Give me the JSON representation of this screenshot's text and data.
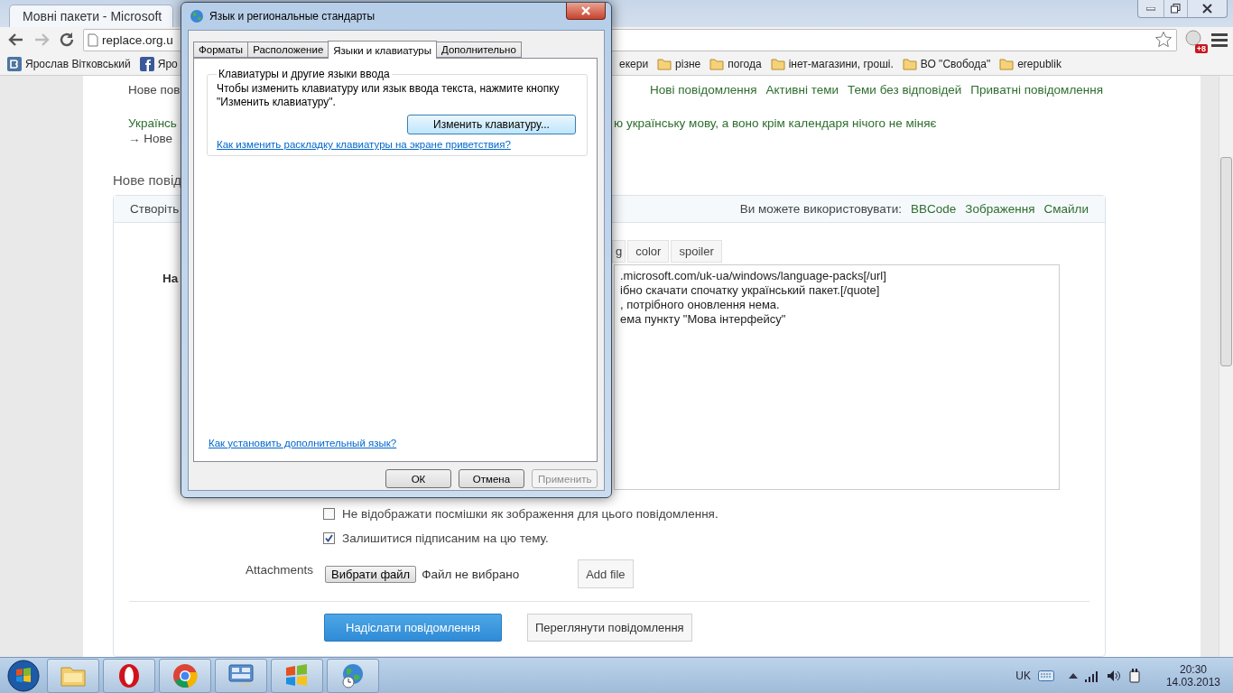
{
  "browser": {
    "tab_title": "Мовні пакети - Microsoft",
    "address": "replace.org.u",
    "extension_badge": "+8",
    "bookmarks": [
      {
        "label": "Ярослав Вітковський",
        "kind": "vk"
      },
      {
        "label": "Яро",
        "kind": "facebook"
      },
      {
        "label": "екери",
        "kind": "cut"
      },
      {
        "label": "різне",
        "kind": "folder"
      },
      {
        "label": "погода",
        "kind": "folder"
      },
      {
        "label": "інет-магазини, гроші.",
        "kind": "folder"
      },
      {
        "label": "ВО \"Свобода\"",
        "kind": "folder"
      },
      {
        "label": "erepublik",
        "kind": "folder"
      }
    ]
  },
  "page": {
    "top_left": "Нове пов",
    "nav_links": [
      "Нові повідомлення",
      "Активні теми",
      "Теми без відповідей",
      "Приватні повідомлення"
    ],
    "topic_start": "Українсь",
    "topic_end": "ю українську мову, а воно крім календаря нічого не міняє",
    "breadcrumb": "→ Нове",
    "section_title": "Нове повід",
    "form": {
      "header_left": "Створіть",
      "header_note": "Ви можете використовувати:",
      "header_links": [
        "BBCode",
        "Зображення",
        "Смайли"
      ],
      "toolbar": [
        "g",
        "color",
        "spoiler"
      ],
      "label": "На",
      "message_lines": [
        ".microsoft.com/uk-ua/windows/language-packs[/url]",
        "ібно скачати спочатку український пакет.[/quote]",
        ", потрібного оновлення нема.",
        "ема пункту \"Мова інтерфейсу\""
      ],
      "options": [
        {
          "label": "Не відображати посмішки як зображення для цього повідомлення.",
          "checked": false
        },
        {
          "label": "Залишитися підписаним на цю тему.",
          "checked": true
        }
      ],
      "attachments_label": "Attachments",
      "file_button": "Вибрати файл",
      "file_status": "Файл не вибрано",
      "add_file": "Add file",
      "submit": "Надіслати повідомлення",
      "preview": "Переглянути повідомлення"
    }
  },
  "dialog": {
    "title": "Язык и региональные стандарты",
    "tabs": [
      {
        "label": "Форматы",
        "selected": false
      },
      {
        "label": "Расположение",
        "selected": false
      },
      {
        "label": "Языки и клавиатуры",
        "selected": true
      },
      {
        "label": "Дополнительно",
        "selected": false
      }
    ],
    "group_title": "Клавиатуры и другие языки ввода",
    "group_text": "Чтобы изменить клавиатуру или язык ввода текста, нажмите кнопку \"Изменить клавиатуру\".",
    "change_button": {
      "label": "Изменить клавиатуру...",
      "focused": true
    },
    "welcome_link": "Как изменить раскладку клавиатуры на экране приветствия?",
    "install_link": "Как установить дополнительный язык?",
    "buttons": [
      {
        "label": "ОК",
        "disabled": false
      },
      {
        "label": "Отмена",
        "disabled": false
      },
      {
        "label": "Применить",
        "disabled": true
      }
    ]
  },
  "taskbar": {
    "apps": [
      {
        "kind": "folder"
      },
      {
        "kind": "opera"
      },
      {
        "kind": "chrome"
      },
      {
        "kind": "control-panel"
      },
      {
        "kind": "windows"
      },
      {
        "kind": "globe"
      }
    ],
    "language": "UK",
    "time": "20:30",
    "date": "14.03.2013"
  }
}
